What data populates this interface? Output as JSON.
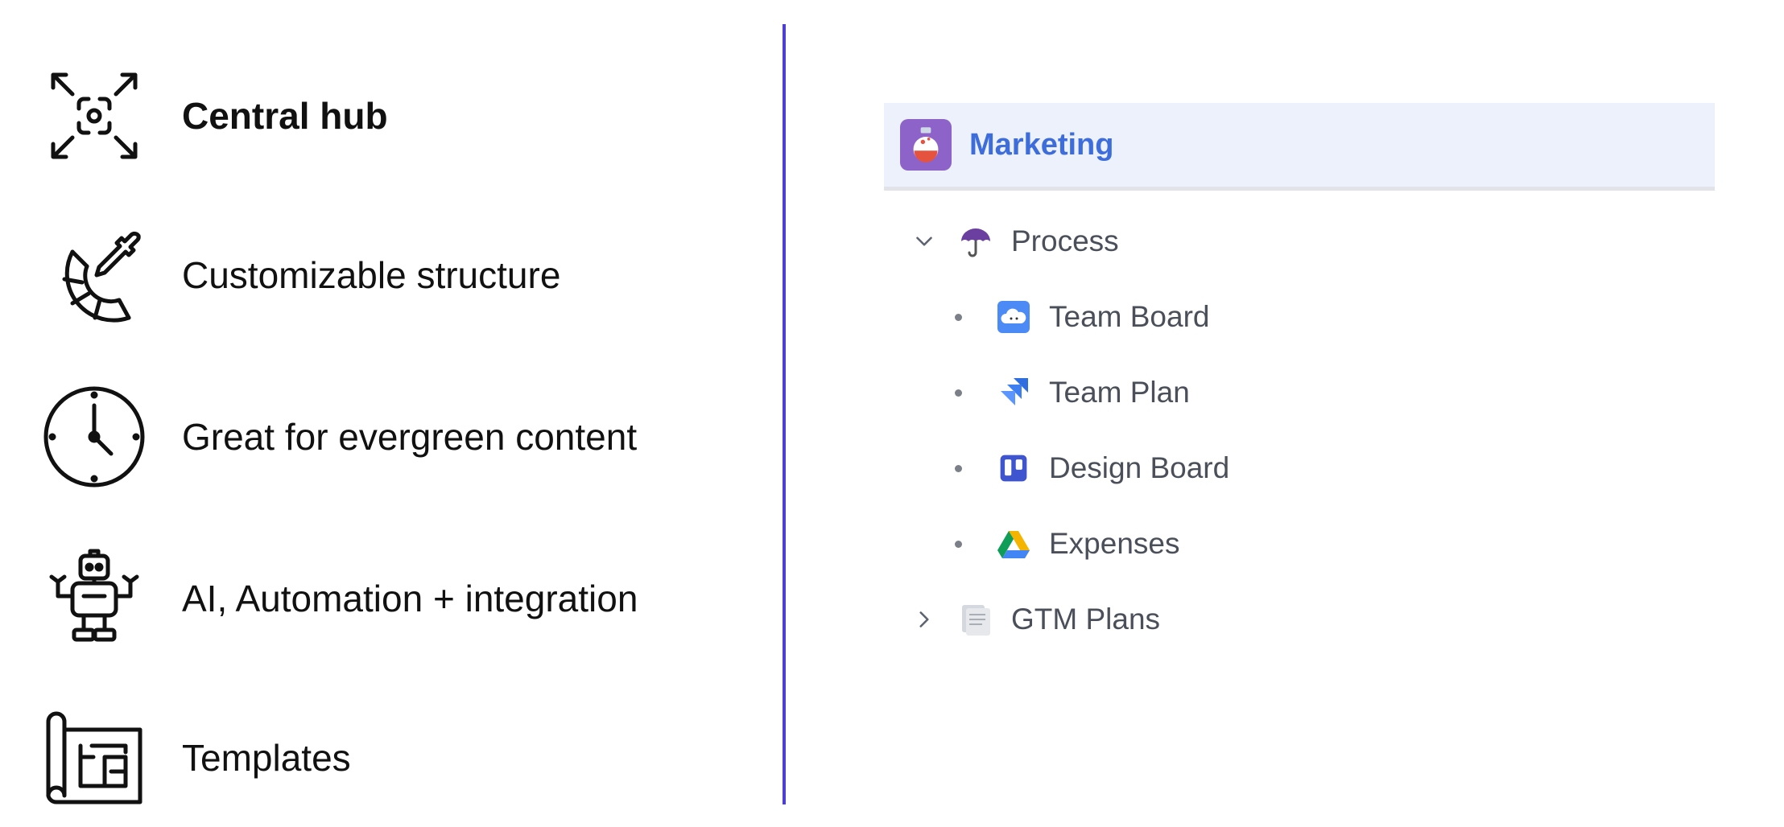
{
  "features": [
    {
      "label": "Central hub",
      "icon": "expand-focus-icon"
    },
    {
      "label": "Customizable structure",
      "icon": "color-palette-dropper-icon"
    },
    {
      "label": "Great for evergreen content",
      "icon": "clock-icon"
    },
    {
      "label": "AI, Automation + integration",
      "icon": "robot-icon"
    },
    {
      "label": "Templates",
      "icon": "blueprint-icon"
    }
  ],
  "space": {
    "name": "Marketing",
    "icon": "potion-bottle-icon",
    "accent": "#3d6ddb",
    "icon_bg": "#8e63c9"
  },
  "tree": {
    "process": {
      "label": "Process",
      "icon": "umbrella-icon",
      "expanded": true
    },
    "children": [
      {
        "label": "Team Board",
        "icon": "cloud-board-icon"
      },
      {
        "label": "Team Plan",
        "icon": "jira-icon"
      },
      {
        "label": "Design Board",
        "icon": "trello-icon"
      },
      {
        "label": "Expenses",
        "icon": "google-drive-icon"
      }
    ],
    "gtm": {
      "label": "GTM Plans",
      "icon": "document-icon",
      "expanded": false
    }
  },
  "colors": {
    "divider": "#4d3fd6",
    "header_bg": "#edf1fb",
    "text": "#4a4f5a"
  }
}
